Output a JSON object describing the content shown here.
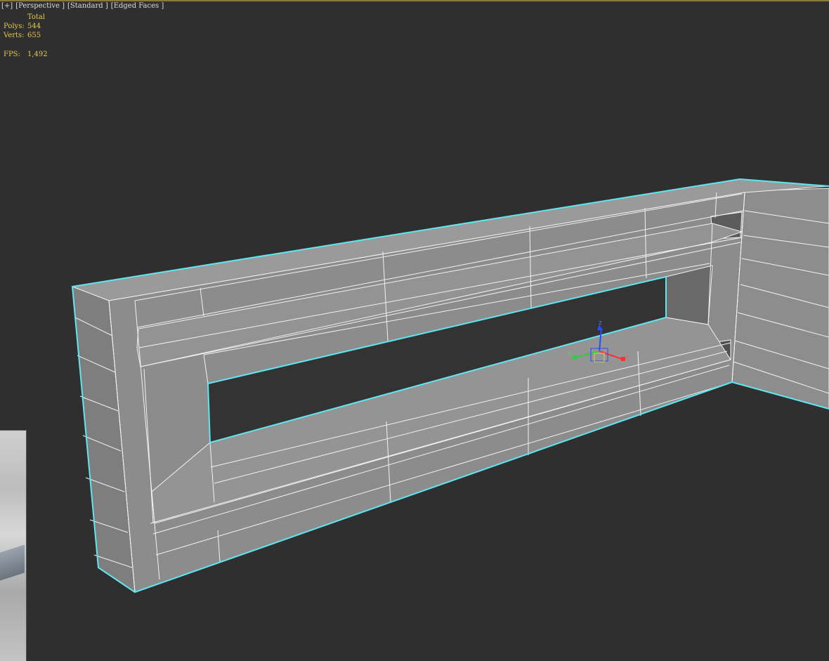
{
  "viewport": {
    "labels": [
      "[+]",
      "[Perspective ]",
      "[Standard ]",
      "[Edged Faces ]"
    ],
    "stats": {
      "header": "Total",
      "polys_label": "Polys:",
      "polys_value": "544",
      "verts_label": "Verts:",
      "verts_value": "655",
      "fps_label": "FPS:",
      "fps_value": "1,492"
    },
    "gizmo": {
      "x_label": "X",
      "y_label": "Y",
      "z_label": "Z"
    }
  },
  "colors": {
    "background": "#2f2f2f",
    "stats_text": "#e6c84a",
    "selection_outline": "#5fe6f0",
    "mesh_face": "#8c8c8c",
    "wire": "#f0f0f0"
  },
  "icons": [
    "transform-gizmo-icon"
  ]
}
